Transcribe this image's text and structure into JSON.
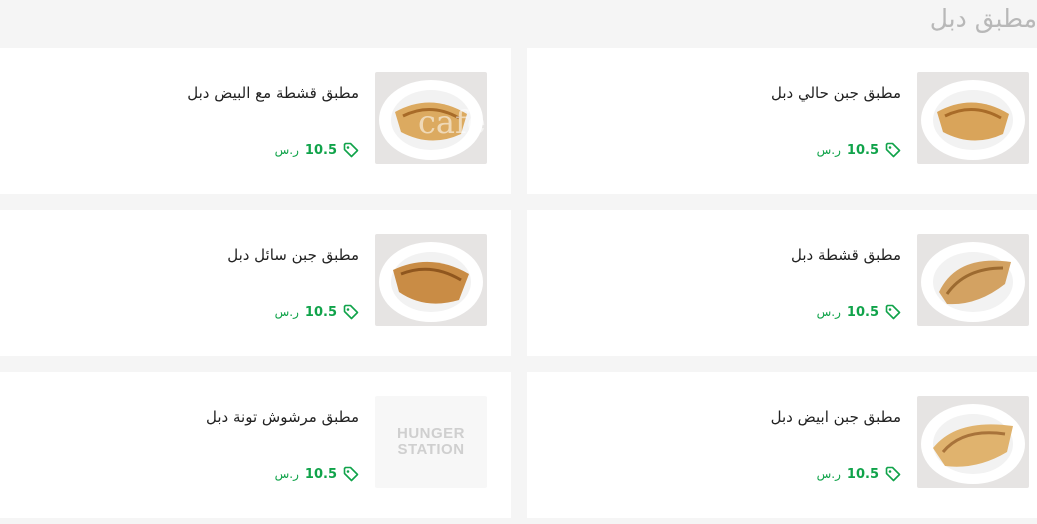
{
  "section": {
    "title": "مطبق دبل"
  },
  "colors": {
    "accent": "#10a34a",
    "background": "#f5f5f5",
    "card": "#ffffff"
  },
  "items": [
    {
      "name": "مطبق جبن حالي دبل",
      "price": "10.5",
      "currency": "ر.س",
      "image": "food-photo"
    },
    {
      "name": "مطبق قشطة مع البيض دبل",
      "price": "10.5",
      "currency": "ر.س",
      "image": "food-photo"
    },
    {
      "name": "مطبق قشطة دبل",
      "price": "10.5",
      "currency": "ر.س",
      "image": "food-photo"
    },
    {
      "name": "مطبق جبن سائل دبل",
      "price": "10.5",
      "currency": "ر.س",
      "image": "food-photo"
    },
    {
      "name": "مطبق جبن ابيض دبل",
      "price": "10.5",
      "currency": "ر.س",
      "image": "food-photo"
    },
    {
      "name": "مطبق مرشوش تونة دبل",
      "price": "10.5",
      "currency": "ر.س",
      "image": "hunger-station-placeholder"
    }
  ],
  "placeholder": {
    "line1": "HUNGER",
    "line2": "STATION"
  },
  "watermark": {
    "text": "cafe"
  },
  "icons": {
    "price": "tag-icon"
  }
}
